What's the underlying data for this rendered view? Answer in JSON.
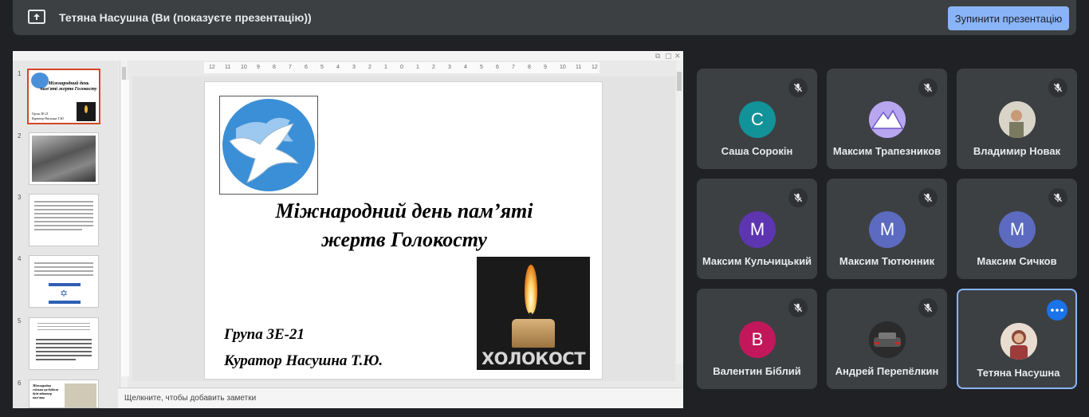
{
  "banner": {
    "presenting_text": "Тетяна Насушна (Ви (показуєте презентацію))",
    "stop_label": "Зупинити презентацію",
    "icon": "present-screen-icon"
  },
  "presentation": {
    "thumbnails": [
      {
        "num": "1",
        "title": "Міжнародний день пам'яті жертв Голокосту",
        "sub1": "Група 3Е-21",
        "sub2": "Куратор Насушна Т.Ю."
      },
      {
        "num": "2"
      },
      {
        "num": "3"
      },
      {
        "num": "4"
      },
      {
        "num": "5"
      },
      {
        "num": "6",
        "text": "Міжнародна спільна ця будівля буде відтепер пам'ять"
      }
    ],
    "ruler_labels": [
      "12",
      "11",
      "10",
      "9",
      "8",
      "7",
      "6",
      "5",
      "4",
      "3",
      "2",
      "1",
      "0",
      "1",
      "2",
      "3",
      "4",
      "5",
      "6",
      "7",
      "8",
      "9",
      "10",
      "11",
      "12"
    ],
    "slide": {
      "title_line1": "Міжнародний день пам’яті",
      "title_line2": "жертв Голокосту",
      "candle_word": "ХОЛОКОСТ",
      "group": "Група 3Е-21",
      "curator": "Куратор Насушна Т.Ю."
    },
    "notes_placeholder": "Щелкните, чтобы добавить заметки"
  },
  "participants": [
    {
      "name": "Саша Сорокін",
      "initial": "C",
      "color": "#12939a",
      "muted": true
    },
    {
      "name": "Максим Трапезников",
      "initial": "",
      "color": "#a98ee6",
      "muted": true,
      "photo": "mountain"
    },
    {
      "name": "Владимир Новак",
      "initial": "",
      "color": "#8a8a7a",
      "muted": true,
      "photo": "person"
    },
    {
      "name": "Максим Кульчицький",
      "initial": "M",
      "color": "#5e35b1",
      "muted": true
    },
    {
      "name": "Максим Тютюнник",
      "initial": "M",
      "color": "#5c6bc0",
      "muted": true
    },
    {
      "name": "Максим Сичков",
      "initial": "M",
      "color": "#5c6bc0",
      "muted": true
    },
    {
      "name": "Валентин Біблий",
      "initial": "B",
      "color": "#c2185b",
      "muted": true
    },
    {
      "name": "Андрей Перепёлкин",
      "initial": "",
      "color": "#222",
      "muted": true,
      "photo": "car"
    },
    {
      "name": "Тетяна Насушна",
      "initial": "",
      "color": "#b07a60",
      "muted": false,
      "photo": "woman",
      "self": true
    }
  ]
}
